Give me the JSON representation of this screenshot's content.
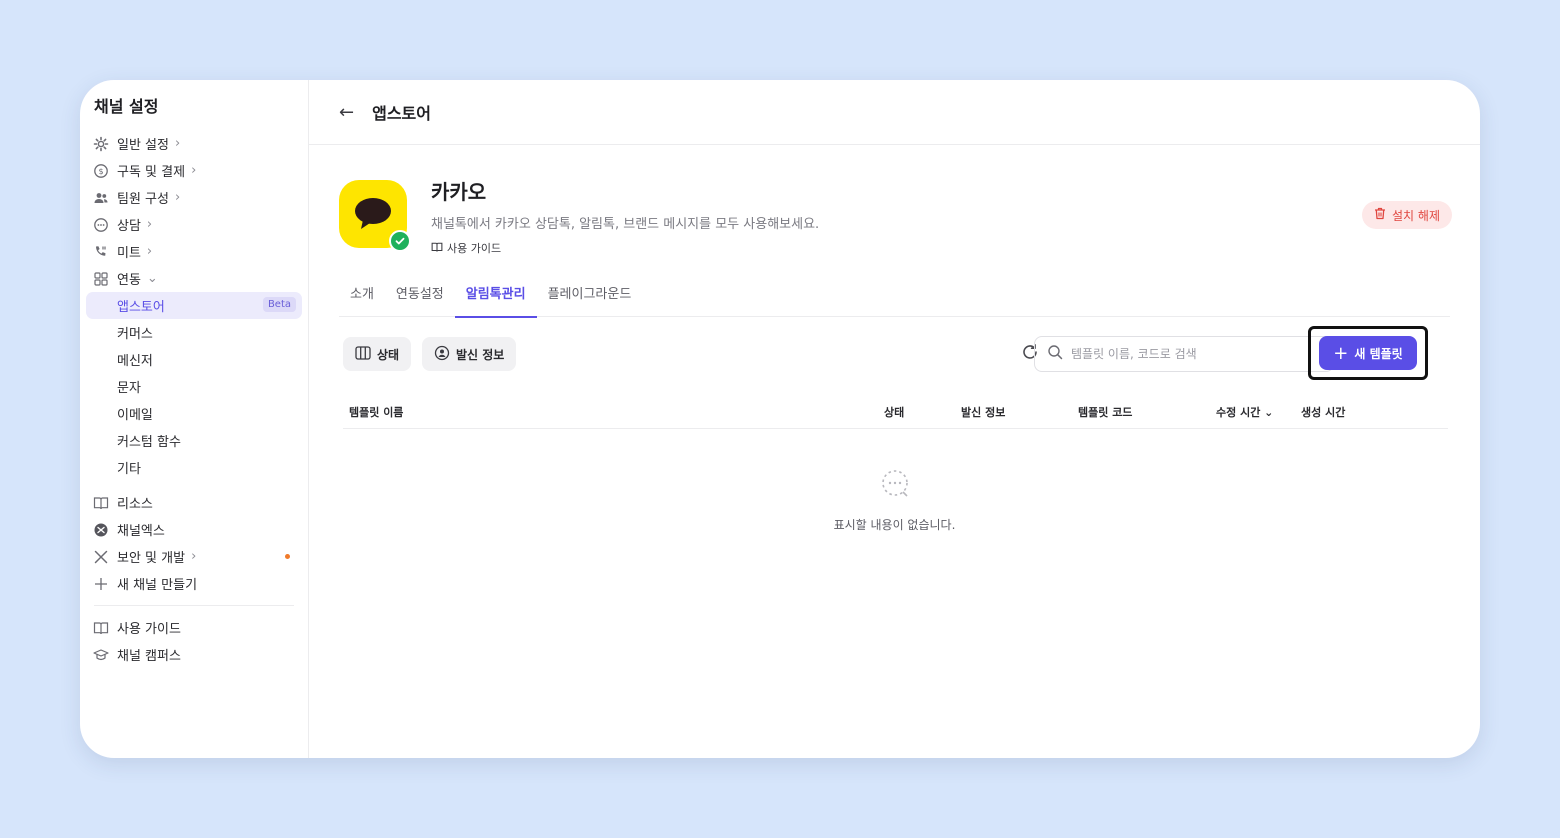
{
  "sidebar": {
    "title": "채널 설정",
    "items": [
      {
        "label": "일반 설정",
        "icon": "gear-icon"
      },
      {
        "label": "구독 및 결제",
        "icon": "coin-icon"
      },
      {
        "label": "팀원 구성",
        "icon": "users-icon"
      },
      {
        "label": "상담",
        "icon": "chat-bubble-icon"
      },
      {
        "label": "미트",
        "icon": "phone-icon"
      },
      {
        "label": "연동",
        "icon": "grid-icon"
      }
    ],
    "sub_items": [
      {
        "label": "앱스토어",
        "badge": "Beta"
      },
      {
        "label": "커머스"
      },
      {
        "label": "메신저"
      },
      {
        "label": "문자"
      },
      {
        "label": "이메일"
      },
      {
        "label": "커스텀 함수"
      },
      {
        "label": "기타"
      }
    ],
    "bottom_items": [
      {
        "label": "리소스",
        "icon": "book-icon"
      },
      {
        "label": "채널엑스",
        "icon": "channelx-icon"
      },
      {
        "label": "보안 및 개발",
        "icon": "tools-icon"
      },
      {
        "label": "새 채널 만들기",
        "icon": "plus-icon"
      }
    ],
    "footer_items": [
      {
        "label": "사용 가이드",
        "icon": "book-icon"
      },
      {
        "label": "채널 캠퍼스",
        "icon": "graduation-cap-icon"
      }
    ]
  },
  "header": {
    "title": "앱스토어"
  },
  "app": {
    "name": "카카오",
    "description": "채널톡에서 카카오 상담톡, 알림톡, 브랜드 메시지를 모두 사용해보세요.",
    "guide_label": "사용 가이드",
    "uninstall_label": "설치 해제"
  },
  "tabs": [
    {
      "label": "소개"
    },
    {
      "label": "연동설정"
    },
    {
      "label": "알림톡관리"
    },
    {
      "label": "플레이그라운드"
    }
  ],
  "toolbar": {
    "status_filter": "상태",
    "sender_filter": "발신 정보",
    "search_placeholder": "템플릿 이름, 코드로 검색",
    "new_template": "새 템플릿"
  },
  "table": {
    "columns": [
      "템플릿 이름",
      "상태",
      "발신 정보",
      "템플릿 코드",
      "수정 시간",
      "생성 시간"
    ],
    "empty_text": "표시할 내용이 없습니다."
  },
  "colors": {
    "accent": "#5a4ee6",
    "kakao_yellow": "#fee500",
    "danger": "#e0463f",
    "success": "#1fb15c"
  }
}
